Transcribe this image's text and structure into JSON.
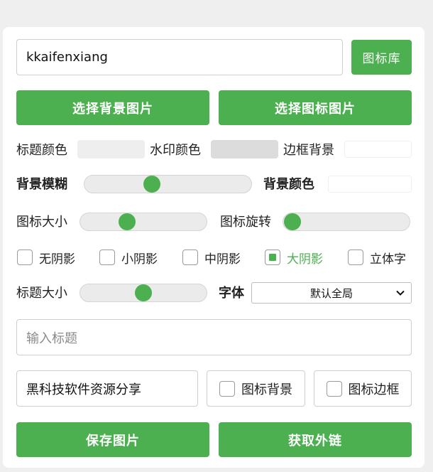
{
  "icon_search": {
    "value": "kkaifenxiang",
    "button_label": "图标库"
  },
  "image_buttons": {
    "background_label": "选择背景图片",
    "icon_label": "选择图标图片"
  },
  "colors_row": {
    "title_color_label": "标题颜色",
    "title_color_value": "#eeeeee",
    "watermark_color_label": "水印颜色",
    "watermark_color_value": "#dcdcdc",
    "border_bg_label": "边框背景",
    "border_bg_value": "#ffffff"
  },
  "blur_row": {
    "blur_label": "背景模糊",
    "blur_level": 0.39,
    "bg_color_label": "背景颜色",
    "bg_color_value": "#ffffff"
  },
  "icon_row": {
    "size_label": "图标大小",
    "size_level": 0.35,
    "rotate_label": "图标旋转",
    "rotate_level": 0.0
  },
  "shadow_options": [
    {
      "label": "无阴影",
      "checked": false
    },
    {
      "label": "小阴影",
      "checked": false
    },
    {
      "label": "中阴影",
      "checked": false
    },
    {
      "label": "大阴影",
      "checked": true
    },
    {
      "label": "立体字",
      "checked": false
    }
  ],
  "title_row": {
    "size_label": "标题大小",
    "size_level": 0.5,
    "font_label": "字体",
    "font_selected": "默认全局"
  },
  "title_input": {
    "placeholder": "输入标题",
    "value": ""
  },
  "watermark": {
    "value": "黑科技软件资源分享",
    "icon_bg_label": "图标背景",
    "icon_bg_checked": false,
    "icon_border_label": "图标边框",
    "icon_border_checked": false
  },
  "actions": {
    "save_label": "保存图片",
    "link_label": "获取外链"
  },
  "theme": {
    "accent": "#4caf50"
  }
}
